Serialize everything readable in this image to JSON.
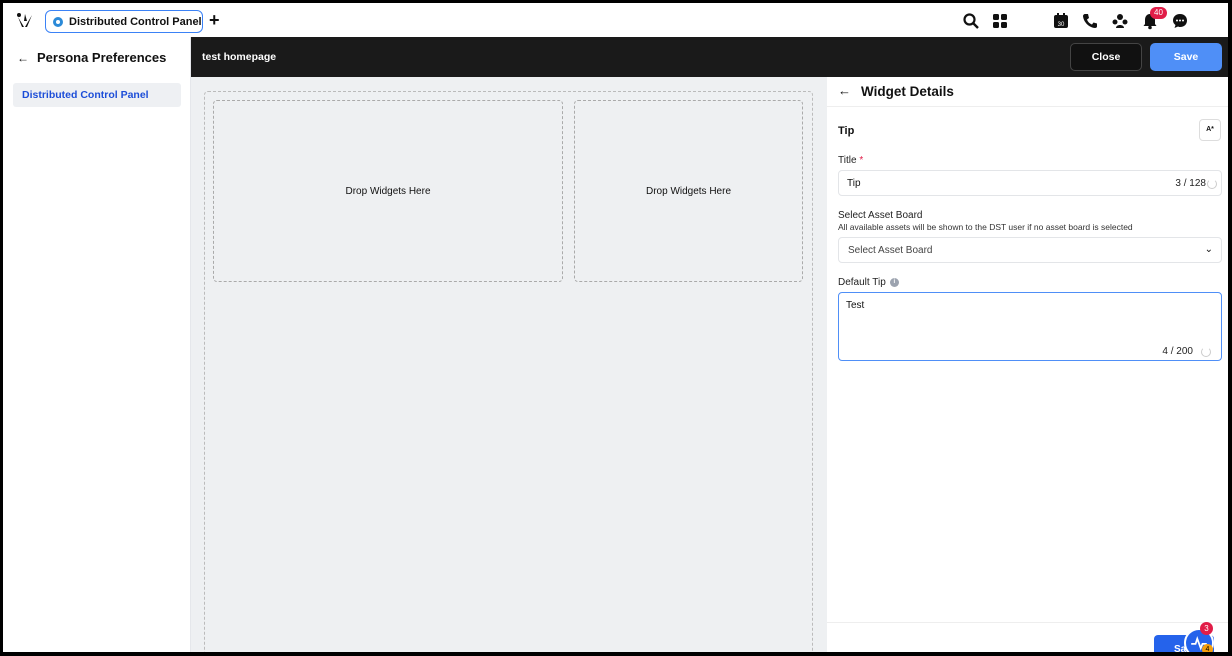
{
  "topbar": {
    "tab_label": "Distributed Control Panel",
    "notifications_count": "40",
    "calendar_day": "30"
  },
  "sidebar": {
    "heading": "Persona Preferences",
    "items": [
      {
        "label": "Distributed Control Panel",
        "active": true
      }
    ]
  },
  "header": {
    "title": "test homepage",
    "close_label": "Close",
    "save_label": "Save"
  },
  "canvas": {
    "zones": [
      "Drop Widgets Here",
      "Drop Widgets Here"
    ]
  },
  "panel": {
    "title": "Widget Details",
    "widget_type": "Tip",
    "translate_label": "A*",
    "title_label": "Title",
    "title_required": "*",
    "title_value": "Tip",
    "title_count": "3 / 128",
    "asset_label": "Select Asset Board",
    "asset_hint": "All available assets will be shown to the DST user if no asset board is selected",
    "asset_placeholder": "Select Asset Board",
    "tip_label": "Default Tip",
    "tip_value": "Test",
    "tip_count": "4 / 200",
    "footer_save_label": "Save"
  },
  "floating": {
    "badge_count": "3",
    "badge_count_2": "4"
  },
  "colors": {
    "accent": "#4f8ff7",
    "header_bg": "#1a1a1a",
    "badge": "#e11d48"
  }
}
